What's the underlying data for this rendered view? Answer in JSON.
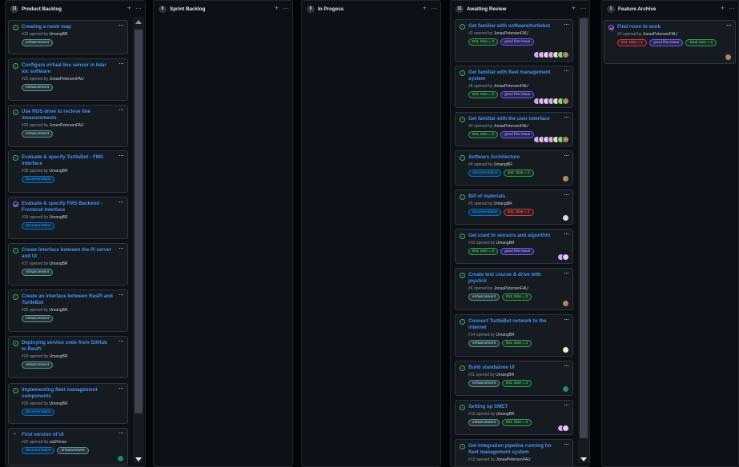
{
  "columns": [
    {
      "count": "11",
      "title": "Product Backlog",
      "cards": [
        {
          "state": "open",
          "title": "Creating a room map",
          "number": "#15",
          "author": "UmangBR",
          "labels": [
            {
              "text": "enhancement",
              "kind": "enh"
            }
          ],
          "avatars": []
        },
        {
          "state": "open",
          "title": "Configure virtual line sensor in lidar loc software",
          "number": "#22",
          "author": "JonasPetersenFAU",
          "labels": [
            {
              "text": "enhancement",
              "kind": "enh"
            }
          ],
          "avatars": []
        },
        {
          "state": "open",
          "title": "Use ROS drive to recieve line measurements",
          "number": "#23",
          "author": "JonasPetersenFAU",
          "labels": [
            {
              "text": "enhancement",
              "kind": "enh"
            }
          ],
          "avatars": []
        },
        {
          "state": "open",
          "title": "Evaluate & specify TurtleBot - FMS interface",
          "number": "#18",
          "author": "UmangBR",
          "labels": [
            {
              "text": "documentation",
              "kind": "doc"
            }
          ],
          "avatars": []
        },
        {
          "state": "closed",
          "title": "Evaluate & specify FMS Backend - Frontend Interface",
          "number": "#19",
          "author": "UmangBR",
          "labels": [
            {
              "text": "documentation",
              "kind": "doc"
            }
          ],
          "avatars": []
        },
        {
          "state": "open",
          "title": "Create interface between the Pi server and UI",
          "number": "#17",
          "author": "UmangBR",
          "labels": [
            {
              "text": "enhancement",
              "kind": "enh"
            }
          ],
          "avatars": []
        },
        {
          "state": "open",
          "title": "Create an interface between RasPi and TurtleBot",
          "number": "#25",
          "author": "UmangBR",
          "labels": [
            {
              "text": "enhancement",
              "kind": "enh"
            }
          ],
          "avatars": []
        },
        {
          "state": "open",
          "title": "Deploying service code from GitHub to RasPi",
          "number": "#24",
          "author": "UmangBR",
          "labels": [
            {
              "text": "enhancement",
              "kind": "enh"
            }
          ],
          "avatars": []
        },
        {
          "state": "open",
          "title": "Implementing fleet management components",
          "number": "#26",
          "author": "UmangBR",
          "labels": [
            {
              "text": "documentation",
              "kind": "doc"
            }
          ],
          "avatars": []
        },
        {
          "state": "pr",
          "title": "First version of UI",
          "number": "#20",
          "author": "cat24max",
          "labels": [
            {
              "text": "documentation",
              "kind": "doc"
            },
            {
              "text": "enhancement",
              "kind": "enh"
            }
          ],
          "avatars": [
            "#1f8a70"
          ]
        }
      ]
    },
    {
      "count": "0",
      "title": "Sprint Backlog",
      "cards": []
    },
    {
      "count": "0",
      "title": "In Progess",
      "cards": []
    },
    {
      "count": "11",
      "title": "Awaiting Review",
      "cards": [
        {
          "state": "open",
          "title": "Get familiar with software/turtlebot",
          "number": "#3",
          "author": "JonasPetersenFAU",
          "labels": [
            {
              "text": "Est. Size = 2",
              "kind": "s2"
            },
            {
              "text": "good first issue",
              "kind": "gfi"
            }
          ],
          "avatars": [
            "#d2a8ff",
            "#e6b3e6",
            "#f0c8f0",
            "#c9b3ff",
            "#ffd7a8",
            "#6fdd8b",
            "#b08a57"
          ]
        },
        {
          "state": "open",
          "title": "Get familiar with fleet management system",
          "number": "#8",
          "author": "JonasPetersenFAU",
          "labels": [
            {
              "text": "Est. Size = 2",
              "kind": "s2"
            },
            {
              "text": "good first issue",
              "kind": "gfi"
            }
          ],
          "avatars": [
            "#d2a8ff",
            "#e6b3e6",
            "#f0c8f0",
            "#c9b3ff",
            "#ffd7a8",
            "#6fdd8b",
            "#b08a57"
          ]
        },
        {
          "state": "open",
          "title": "Get familiar with the user interface",
          "number": "#9",
          "author": "JonasPetersenFAU",
          "labels": [
            {
              "text": "Est. Size = 2",
              "kind": "s2"
            },
            {
              "text": "good first issue",
              "kind": "gfi"
            }
          ],
          "avatars": [
            "#d2a8ff",
            "#e6b3e6",
            "#f0c8f0",
            "#c9b3ff",
            "#ffd7a8",
            "#6fdd8b",
            "#b08a57"
          ]
        },
        {
          "state": "open",
          "title": "Software Architecture",
          "number": "#4",
          "author": "UmangBR",
          "labels": [
            {
              "text": "documentation",
              "kind": "doc"
            },
            {
              "text": "Est. Size = 2",
              "kind": "s2"
            }
          ],
          "avatars": [
            "#b08a57"
          ]
        },
        {
          "state": "open",
          "title": "Bill of materials",
          "number": "#5",
          "author": "UmangBR",
          "labels": [
            {
              "text": "documentation",
              "kind": "doc"
            },
            {
              "text": "Est. Size = 1",
              "kind": "s1"
            }
          ],
          "avatars": [
            "#e8d5f5"
          ]
        },
        {
          "state": "open",
          "title": "Get used to sensors and algorithm",
          "number": "#10",
          "author": "UmangBR",
          "labels": [
            {
              "text": "Est. Size = 2",
              "kind": "s2"
            },
            {
              "text": "good first issue",
              "kind": "gfi"
            }
          ],
          "avatars": [
            "#d2a8ff",
            "#f0c8f0"
          ]
        },
        {
          "state": "open",
          "title": "Create test course & drive with joystick",
          "number": "#6",
          "author": "JonasPetersenFAU",
          "labels": [
            {
              "text": "enhancement",
              "kind": "enh"
            },
            {
              "text": "Est. Size = 2",
              "kind": "s2"
            }
          ],
          "avatars": [
            "#b08a57"
          ]
        },
        {
          "state": "open",
          "title": "Connect TurtleBot network to the internet",
          "number": "#14",
          "author": "UmangBR",
          "labels": [
            {
              "text": "enhancement",
              "kind": "enh"
            },
            {
              "text": "Est. Size = 2",
              "kind": "s2"
            }
          ],
          "avatars": [
            "#e8f5c8"
          ]
        },
        {
          "state": "open",
          "title": "Build standalone UI",
          "number": "#11",
          "author": "UmangBR",
          "labels": [
            {
              "text": "enhancement",
              "kind": "enh"
            },
            {
              "text": "Est. Size = 2",
              "kind": "s2"
            }
          ],
          "avatars": [
            "#1f8a70"
          ]
        },
        {
          "state": "open",
          "title": "Setting up SMET",
          "number": "#13",
          "author": "UmangBR",
          "labels": [
            {
              "text": "enhancement",
              "kind": "enh"
            },
            {
              "text": "Est. Size = 2",
              "kind": "s2"
            }
          ],
          "avatars": [
            "#d2a8ff",
            "#f0c8f0"
          ]
        },
        {
          "state": "open",
          "title": "Get integration pipeline running for fleet management system",
          "number": "#12",
          "author": "JonasPetersenFAU",
          "labels": [],
          "avatars": []
        }
      ]
    },
    {
      "count": "1",
      "title": "Feature Archive",
      "cards": [
        {
          "state": "closed",
          "title": "Find room to work",
          "number": "#2",
          "author": "JonasPetersenFAU",
          "labels": [
            {
              "text": "Est. Size = 1",
              "kind": "s1"
            },
            {
              "text": "good first issue",
              "kind": "gfi"
            },
            {
              "text": "Real Size = 2",
              "kind": "s2"
            }
          ],
          "avatars": [
            "#b08a57"
          ]
        }
      ]
    }
  ],
  "opened_by_text": "opened by",
  "column_actions": {
    "add": "+",
    "more": "···"
  },
  "card_menu": "···",
  "icons": {
    "add": "plus-icon",
    "more": "kebab-icon",
    "open": "issue-open-icon",
    "closed": "issue-closed-icon",
    "pr": "pull-request-icon"
  }
}
